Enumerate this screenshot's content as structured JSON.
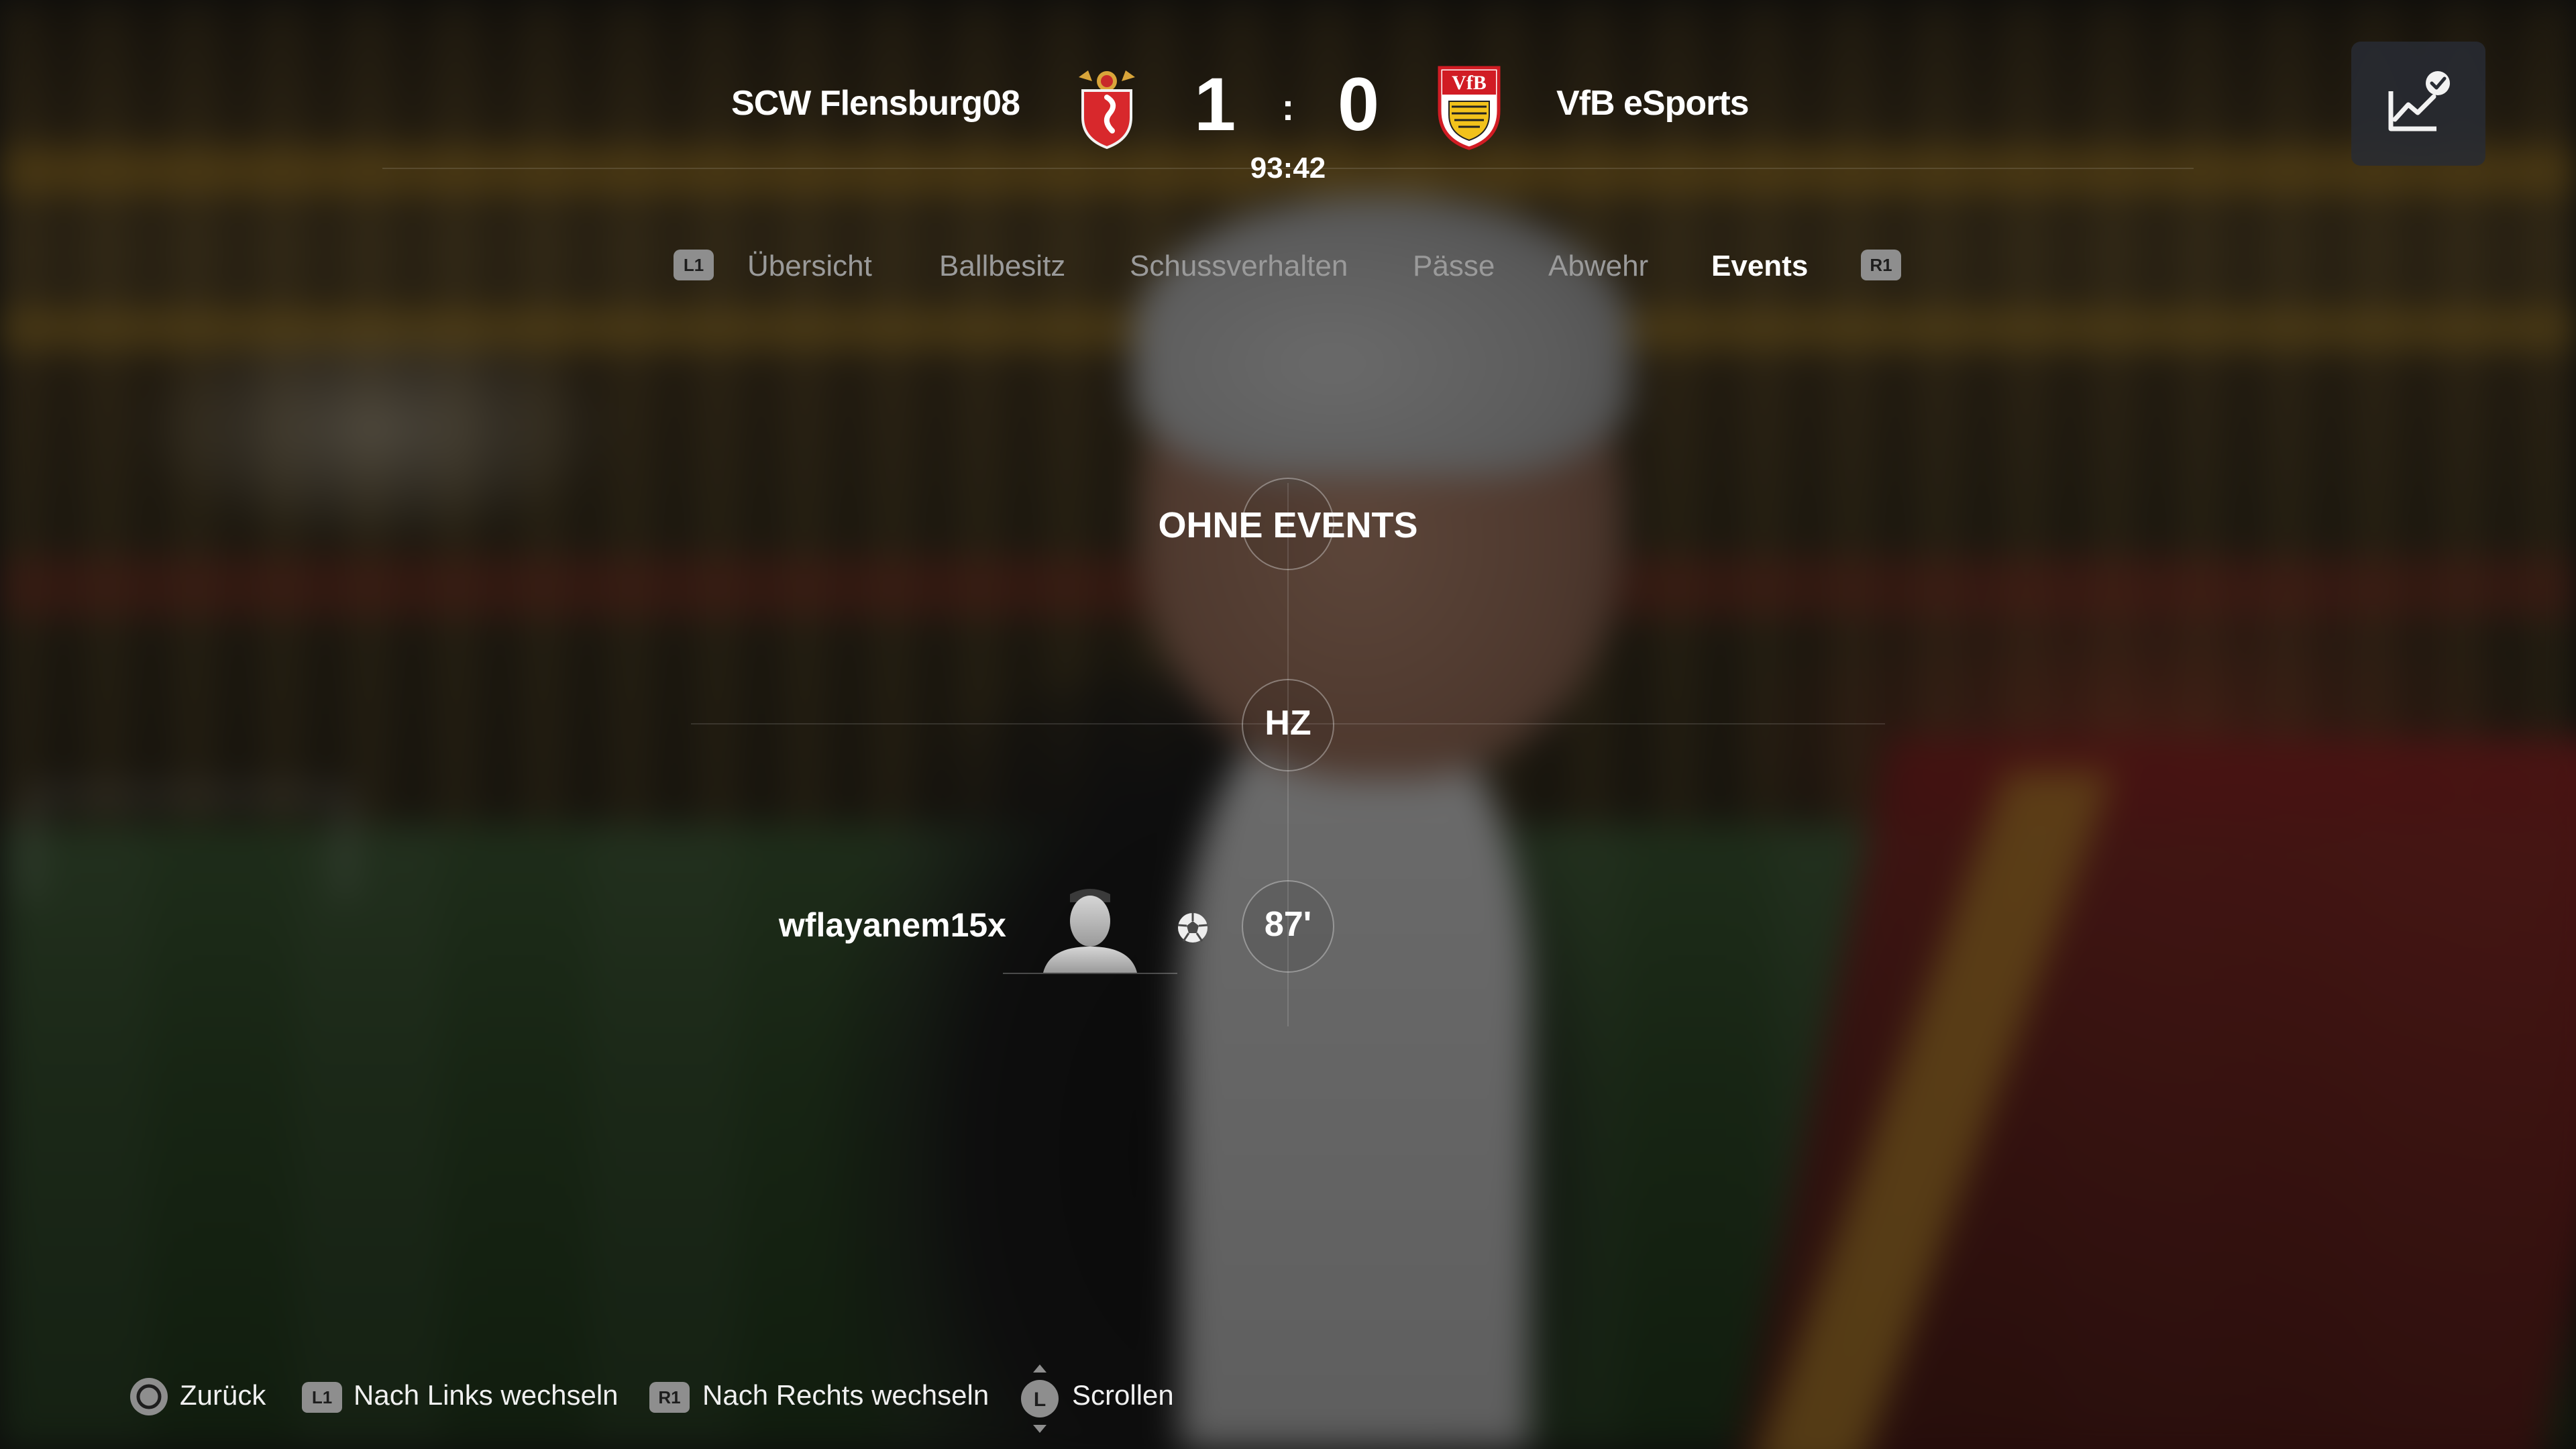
{
  "match": {
    "home_team": "SCW Flensburg08",
    "away_team": "VfB eSports",
    "home_score": "1",
    "separator": ":",
    "away_score": "0",
    "clock": "93:42"
  },
  "tabs": {
    "left_shoulder": "L1",
    "right_shoulder": "R1",
    "items": [
      {
        "label": "Übersicht"
      },
      {
        "label": "Ballbesitz"
      },
      {
        "label": "Schussverhalten"
      },
      {
        "label": "Pässe"
      },
      {
        "label": "Abwehr"
      },
      {
        "label": "Events"
      }
    ],
    "active": "Events"
  },
  "timeline": {
    "no_events": "OHNE EVENTS",
    "halftime": "HZ",
    "events": [
      {
        "minute": "87'",
        "player": "wflayanem15x",
        "type": "goal",
        "icon": "soccer-ball-icon"
      }
    ]
  },
  "footer": {
    "back": {
      "label": "Zurück",
      "button": "circle"
    },
    "left": {
      "label": "Nach Links wechseln",
      "button": "L1"
    },
    "right": {
      "label": "Nach Rechts wechseln",
      "button": "R1"
    },
    "scroll": {
      "label": "Scrollen",
      "button": "L"
    }
  },
  "colors": {
    "accent": "#ffffff",
    "inactive_tab": "#9a9a9a",
    "button_badge": "#8e8e8e",
    "panel": "#282c34"
  }
}
